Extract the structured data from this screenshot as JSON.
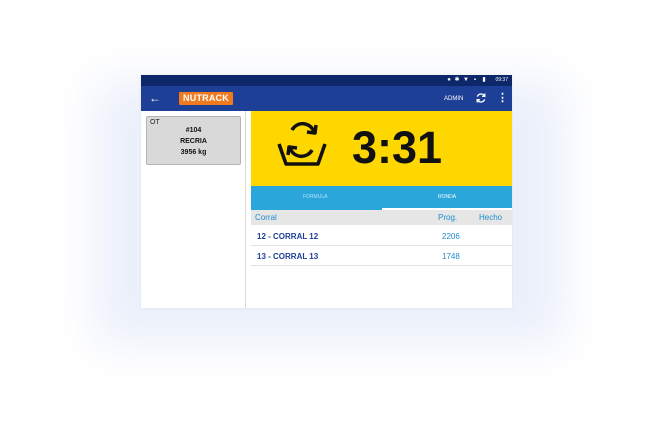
{
  "statusbar": {
    "time": "09:37",
    "icons": [
      "location-icon",
      "bluetooth-icon",
      "wifi-icon",
      "sim-icon",
      "battery-icon"
    ]
  },
  "appbar": {
    "back_icon": "arrow-back-icon",
    "brand": "NUTRACK",
    "user": "ADMIN",
    "sync_icon": "refresh-icon",
    "menu_icon": "more-vert-icon"
  },
  "card": {
    "label": "OT",
    "number": "#104",
    "type": "RECRIA",
    "weight": "3956 kg"
  },
  "timer": {
    "value": "3:31",
    "icon": "mixing-wagon-icon"
  },
  "tabs": [
    {
      "label": "FORMULA"
    },
    {
      "label": "RONDA"
    }
  ],
  "table": {
    "headers": {
      "corral": "Corral",
      "prog": "Prog.",
      "hecho": "Hecho"
    },
    "rows": [
      {
        "name": "12 - CORRAL 12",
        "prog": "2206",
        "hecho": ""
      },
      {
        "name": "13 - CORRAL 13",
        "prog": "1748",
        "hecho": ""
      }
    ]
  },
  "colors": {
    "appbar": "#1d3f95",
    "statusbar": "#0d2869",
    "brand": "#f07b1f",
    "timer_bg": "#fed600",
    "tabs": "#2aa6da",
    "accent_text": "#1b8ccf"
  }
}
